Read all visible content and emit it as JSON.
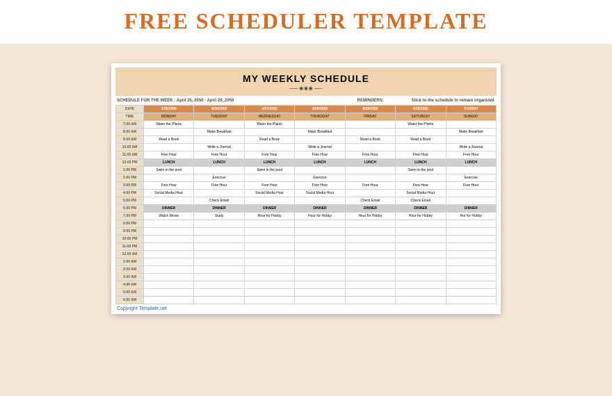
{
  "banner": {
    "title": "FREE SCHEDULER TEMPLATE"
  },
  "sheet": {
    "title": "MY WEEKLY SCHEDULE",
    "divider": "── ❀❀❀ ──",
    "schedule_label": "SCHEDULE FOR THE WEEK :",
    "date_range": "April 25, 2050 - April 29, 2050",
    "reminders_label": "REMINDERS:",
    "reminders_text": "Stick to the schedule to remain organized.",
    "copyright": "Copyright Template.net"
  },
  "header": {
    "date_label": "DATE",
    "time_label": "TIME",
    "dates": [
      "4/25/2050",
      "4/26/2050",
      "4/27/2050",
      "4/28/2050",
      "4/29/2050",
      "4/30/2050",
      "5/1/2050"
    ],
    "days": [
      "MONDAY",
      "TUESDAY",
      "WEDNESDAY",
      "THURSDAY",
      "FRIDAY",
      "SATURDAY",
      "SUNDAY"
    ]
  },
  "times": [
    "7:00 AM",
    "8:00 AM",
    "9:00 AM",
    "10:00 AM",
    "11:00 AM",
    "12:00 PM",
    "1:00 PM",
    "2:00 PM",
    "3:00 PM",
    "4:00 PM",
    "5:00 PM",
    "6:00 PM",
    "7:00 PM",
    "8:00 PM",
    "9:00 PM",
    "10:00 PM",
    "11:00 PM",
    "12:00 AM",
    "1:00 AM",
    "2:00 AM",
    "3:00 AM",
    "4:00 AM",
    "5:00 AM",
    "6:00 AM"
  ],
  "rows": [
    [
      "Water the Plants",
      "",
      "Water the Plants",
      "",
      "",
      "Water the Plants",
      ""
    ],
    [
      "",
      "Make Breakfast",
      "",
      "Make Breakfast",
      "",
      "",
      "Make Breakfast"
    ],
    [
      "Read a Book",
      "",
      "Read a Book",
      "",
      "Read a Book",
      "Read a Book",
      ""
    ],
    [
      "",
      "Write a Journal",
      "",
      "Write a Journal",
      "",
      "",
      "Write a Journal"
    ],
    [
      "Free Hour",
      "Free Hour",
      "Free Hour",
      "Free Hour",
      "Free Hour",
      "Free Hour",
      "Free Hour"
    ],
    [
      "LUNCH",
      "LUNCH",
      "LUNCH",
      "LUNCH",
      "LUNCH",
      "LUNCH",
      "LUNCH"
    ],
    [
      "Swim in the pool",
      "",
      "Swim in the pool",
      "",
      "",
      "Swim in the pool",
      ""
    ],
    [
      "",
      "Exercise",
      "",
      "Exercise",
      "",
      "",
      "Exercise"
    ],
    [
      "Free Hour",
      "Free Hour",
      "Free Hour",
      "Free Hour",
      "Free Hour",
      "Free Hour",
      "Free Hour"
    ],
    [
      "Social Media Hour",
      "",
      "Social Media Hour",
      "Social Media Hour",
      "",
      "Social Media Hour",
      ""
    ],
    [
      "",
      "Check Email",
      "",
      "",
      "Check Email",
      "Check Email",
      ""
    ],
    [
      "DINNER",
      "DINNER",
      "DINNER",
      "DINNER",
      "DINNER",
      "DINNER",
      "DINNER"
    ],
    [
      "Watch Movie",
      "Study",
      "Hour for Hobby",
      "Hour for Hobby",
      "Hour for Hobby",
      "Hour for Hobby",
      "Hor for Hobby"
    ],
    [
      "",
      "",
      "",
      "",
      "",
      "",
      ""
    ],
    [
      "",
      "",
      "",
      "",
      "",
      "",
      ""
    ],
    [
      "",
      "",
      "",
      "",
      "",
      "",
      ""
    ],
    [
      "",
      "",
      "",
      "",
      "",
      "",
      ""
    ],
    [
      "",
      "",
      "",
      "",
      "",
      "",
      ""
    ],
    [
      "",
      "",
      "",
      "",
      "",
      "",
      ""
    ],
    [
      "",
      "",
      "",
      "",
      "",
      "",
      ""
    ],
    [
      "",
      "",
      "",
      "",
      "",
      "",
      ""
    ],
    [
      "",
      "",
      "",
      "",
      "",
      "",
      ""
    ],
    [
      "",
      "",
      "",
      "",
      "",
      "",
      ""
    ],
    [
      "",
      "",
      "",
      "",
      "",
      "",
      ""
    ]
  ]
}
